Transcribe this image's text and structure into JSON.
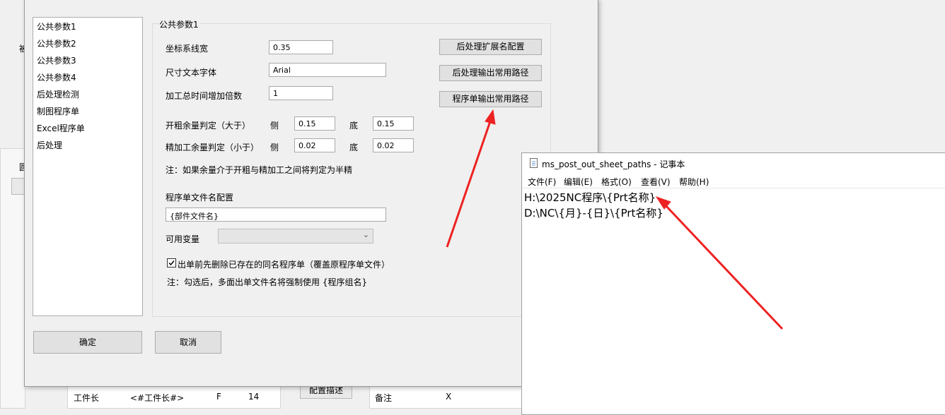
{
  "background": {
    "left_label_1": "被",
    "left_label_2": "圆",
    "table_row": {
      "name": "工件长",
      "code": "<#工件长#>",
      "type": "F",
      "value": "14"
    },
    "describe_button": "配置描述",
    "remark_label": "备注",
    "remark_value": "X"
  },
  "dialog": {
    "nav_items": [
      "公共参数1",
      "公共参数2",
      "公共参数3",
      "公共参数4",
      "后处理检测",
      "制图程序单",
      "Excel程序单",
      "后处理"
    ],
    "group_title": "公共参数1",
    "coord_line_width": {
      "label": "坐标系线宽",
      "value": "0.35"
    },
    "dim_font": {
      "label": "尺寸文本字体",
      "value": "Arial"
    },
    "time_multiplier": {
      "label": "加工总时间增加倍数",
      "value": "1"
    },
    "rough_stock": {
      "label": "开粗余量判定（大于）",
      "side_label": "侧",
      "side_value": "0.15",
      "bottom_label": "底",
      "bottom_value": "0.15"
    },
    "finish_stock": {
      "label": "精加工余量判定（小于）",
      "side_label": "侧",
      "side_value": "0.02",
      "bottom_label": "底",
      "bottom_value": "0.02"
    },
    "stock_note": "注：如果余量介于开粗与精加工之间将判定为半精",
    "sheet_name_config_label": "程序单文件名配置",
    "sheet_name_value": "{部件文件名}",
    "variables_label": "可用变量",
    "variables_selected": "",
    "delete_existing_checked": true,
    "delete_existing_label": "出单前先删除已存在的同名程序单（覆盖原程序单文件）",
    "delete_note": "注：勾选后，多面出单文件名将强制使用 {程序组名}",
    "buttons": {
      "ext_config": "后处理扩展名配置",
      "output_paths": "后处理输出常用路径",
      "sheet_paths": "程序单输出常用路径",
      "ok": "确定",
      "cancel": "取消"
    }
  },
  "notepad": {
    "title": "ms_post_out_sheet_paths - 记事本",
    "menu": [
      "文件(F)",
      "编辑(E)",
      "格式(O)",
      "查看(V)",
      "帮助(H)"
    ],
    "lines": [
      "H:\\2025NC程序\\{Prt名称}",
      "D:\\NC\\{月}-{日}\\{Prt名称}"
    ]
  },
  "annotation": {
    "arrow_color": "#ee2222"
  }
}
